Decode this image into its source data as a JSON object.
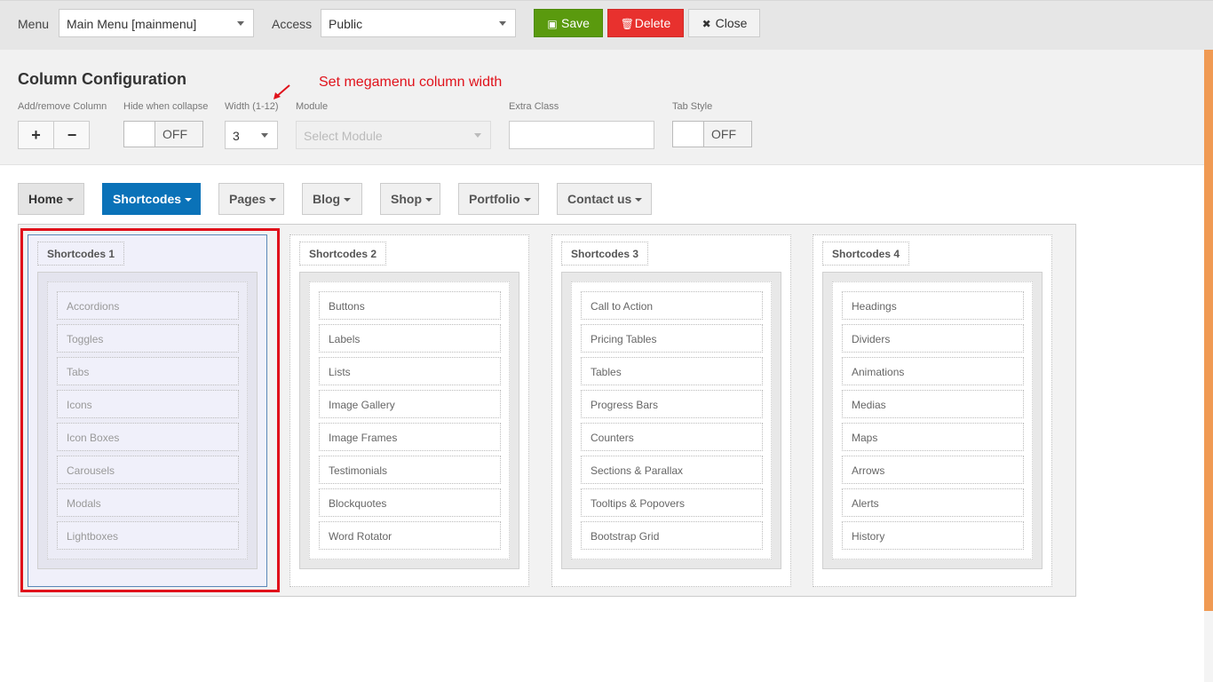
{
  "toolbar": {
    "menu_label": "Menu",
    "menu_value": "Main Menu [mainmenu]",
    "access_label": "Access",
    "access_value": "Public",
    "save_label": "Save",
    "delete_label": "Delete",
    "close_label": "Close"
  },
  "config": {
    "title": "Column Configuration",
    "annotation": "Set megamenu column width",
    "add_remove_label": "Add/remove Column",
    "plus": "+",
    "minus": "−",
    "hide_label": "Hide when collapse",
    "hide_value": "OFF",
    "width_label": "Width (1-12)",
    "width_value": "3",
    "module_label": "Module",
    "module_placeholder": "Select Module",
    "extra_class_label": "Extra Class",
    "extra_class_value": "",
    "tab_style_label": "Tab Style",
    "tab_style_value": "OFF"
  },
  "nav": [
    "Home",
    "Shortcodes",
    "Pages",
    "Blog",
    "Shop",
    "Portfolio",
    "Contact us"
  ],
  "columns": [
    {
      "title": "Shortcodes 1",
      "items": [
        "Accordions",
        "Toggles",
        "Tabs",
        "Icons",
        "Icon Boxes",
        "Carousels",
        "Modals",
        "Lightboxes"
      ]
    },
    {
      "title": "Shortcodes 2",
      "items": [
        "Buttons",
        "Labels",
        "Lists",
        "Image Gallery",
        "Image Frames",
        "Testimonials",
        "Blockquotes",
        "Word Rotator"
      ]
    },
    {
      "title": "Shortcodes 3",
      "items": [
        "Call to Action",
        "Pricing Tables",
        "Tables",
        "Progress Bars",
        "Counters",
        "Sections & Parallax",
        "Tooltips & Popovers",
        "Bootstrap Grid"
      ]
    },
    {
      "title": "Shortcodes 4",
      "items": [
        "Headings",
        "Dividers",
        "Animations",
        "Medias",
        "Maps",
        "Arrows",
        "Alerts",
        "History"
      ]
    }
  ],
  "colors": {
    "save": "#5a9a0e",
    "delete": "#e8312e",
    "active_nav": "#0a72b8",
    "highlight": "#e00f1a"
  }
}
